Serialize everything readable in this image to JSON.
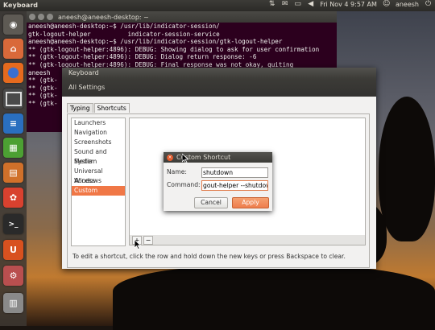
{
  "top_panel": {
    "app_title": "Keyboard",
    "clock": "Fri Nov 4  9:57 AM",
    "user": "aneesh",
    "tray_icons": [
      "network-icon",
      "mail-icon",
      "battery-icon",
      "volume-icon",
      "user-icon",
      "power-icon"
    ]
  },
  "launcher": {
    "items": [
      {
        "name": "dash-home",
        "icon": "ubuntu-logo-icon",
        "color": "#5e5a54"
      },
      {
        "name": "home-folder",
        "icon": "folder-icon",
        "color": "#d9693a"
      },
      {
        "name": "firefox",
        "icon": "firefox-icon",
        "color": "#e66a1e"
      },
      {
        "name": "workspaces",
        "icon": "workspace-icon",
        "color": "#4a4a4a"
      },
      {
        "name": "libreoffice-writer",
        "icon": "writer-icon",
        "color": "#2a6fbf"
      },
      {
        "name": "libreoffice-calc",
        "icon": "calc-icon",
        "color": "#4ca033"
      },
      {
        "name": "libreoffice-impress",
        "icon": "impress-icon",
        "color": "#d0702a"
      },
      {
        "name": "software-center",
        "icon": "software-center-icon",
        "color": "#d8412f"
      },
      {
        "name": "terminal",
        "icon": "terminal-icon",
        "color": "#2a2a2a"
      },
      {
        "name": "ubuntu-one",
        "icon": "ubuntu-one-icon",
        "color": "#d8511f"
      },
      {
        "name": "system-settings",
        "icon": "settings-icon",
        "color": "#b94f4f"
      },
      {
        "name": "trash",
        "icon": "trash-icon",
        "color": "#8a8a8a"
      }
    ]
  },
  "terminal": {
    "title": "aneesh@aneesh-desktop: ~",
    "lines": [
      "aneesh@aneesh-desktop:~$ /usr/lib/indicator-session/",
      "gtk-logout-helper          indicator-session-service",
      "aneesh@aneesh-desktop:~$ /usr/lib/indicator-session/gtk-logout-helper",
      "** (gtk-logout-helper:4896): DEBUG: Showing dialog to ask for user confirmation",
      "** (gtk-logout-helper:4896): DEBUG: Dialog return response: -6",
      "** (gtk-logout-helper:4896): DEBUG: Final response was not okay, quiting",
      "aneesh",
      "** (gtk-",
      "** (gtk-",
      "** (gtk-",
      "** (gtk-"
    ]
  },
  "keyboard": {
    "title": "Keyboard",
    "all_settings": "All Settings",
    "tabs": [
      {
        "label": "Typing",
        "active": false
      },
      {
        "label": "Shortcuts",
        "active": true
      }
    ],
    "categories": [
      {
        "label": "Launchers",
        "selected": false
      },
      {
        "label": "Navigation",
        "selected": false
      },
      {
        "label": "Screenshots",
        "selected": false
      },
      {
        "label": "Sound and Media",
        "selected": false
      },
      {
        "label": "System",
        "selected": false
      },
      {
        "label": "Universal Access",
        "selected": false
      },
      {
        "label": "Windows",
        "selected": false
      },
      {
        "label": "Custom Shortcuts",
        "selected": true
      }
    ],
    "add_label": "+",
    "remove_label": "−",
    "hint": "To edit a shortcut, click the row and hold down the new keys or press Backspace to clear."
  },
  "dialog": {
    "title": "Custom Shortcut",
    "name_label": "Name:",
    "name_value": "shutdown",
    "command_label": "Command:",
    "command_value": "gout-helper --shutdown",
    "cancel_label": "Cancel",
    "apply_label": "Apply",
    "accent": "#ee7d4c"
  }
}
